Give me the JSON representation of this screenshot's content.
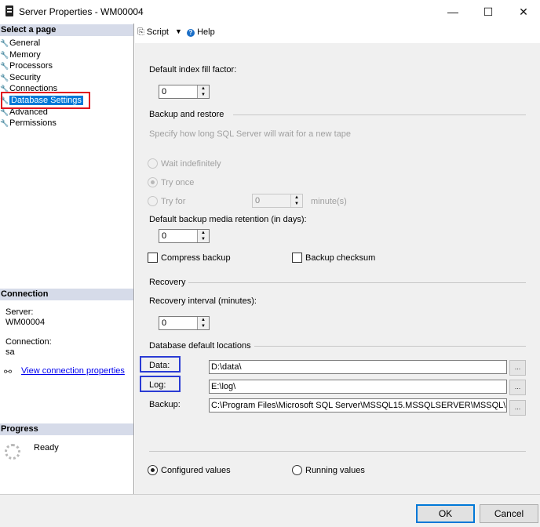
{
  "window": {
    "title": "Server Properties - WM00004",
    "minimize_glyph": "—",
    "maximize_glyph": "☐",
    "close_glyph": "✕"
  },
  "left": {
    "select_page_header": "Select a page",
    "pages": [
      {
        "label": "General"
      },
      {
        "label": "Memory"
      },
      {
        "label": "Processors"
      },
      {
        "label": "Security"
      },
      {
        "label": "Connections"
      },
      {
        "label": "Database Settings"
      },
      {
        "label": "Advanced"
      },
      {
        "label": "Permissions"
      }
    ],
    "selected_index": 5,
    "connection_header": "Connection",
    "server_label": "Server:",
    "server_value": "WM00004",
    "connection_label": "Connection:",
    "connection_value": "sa",
    "view_connection_link": "View connection properties",
    "progress_header": "Progress",
    "progress_status": "Ready"
  },
  "toolbar": {
    "script_label": "Script",
    "help_label": "Help"
  },
  "form": {
    "fill_factor_label": "Default index fill factor:",
    "fill_factor_value": "0",
    "backup_restore_title": "Backup and restore",
    "tape_hint": "Specify how long SQL Server will wait for a new tape",
    "wait_indefinitely": "Wait indefinitely",
    "try_once": "Try once",
    "try_for": "Try for",
    "try_for_value": "0",
    "minutes_unit": "minute(s)",
    "retention_label": "Default backup media retention (in days):",
    "retention_value": "0",
    "compress_backup": "Compress backup",
    "backup_checksum": "Backup checksum",
    "recovery_title": "Recovery",
    "recovery_interval_label": "Recovery interval (minutes):",
    "recovery_interval_value": "0",
    "default_locations_title": "Database default locations",
    "data_label": "Data:",
    "data_value": "D:\\data\\",
    "log_label": "Log:",
    "log_value": "E:\\log\\",
    "backup_label": "Backup:",
    "backup_value": "C:\\Program Files\\Microsoft SQL Server\\MSSQL15.MSSQLSERVER\\MSSQL\\Ba",
    "browse_label": "...",
    "configured_values": "Configured values",
    "running_values": "Running values"
  },
  "buttons": {
    "ok": "OK",
    "cancel": "Cancel"
  },
  "colors": {
    "selection_blue": "#0078d7",
    "highlight_red": "#e0141e",
    "highlight_blue": "#2a3bd4",
    "header_bg": "#d6dbe9"
  }
}
